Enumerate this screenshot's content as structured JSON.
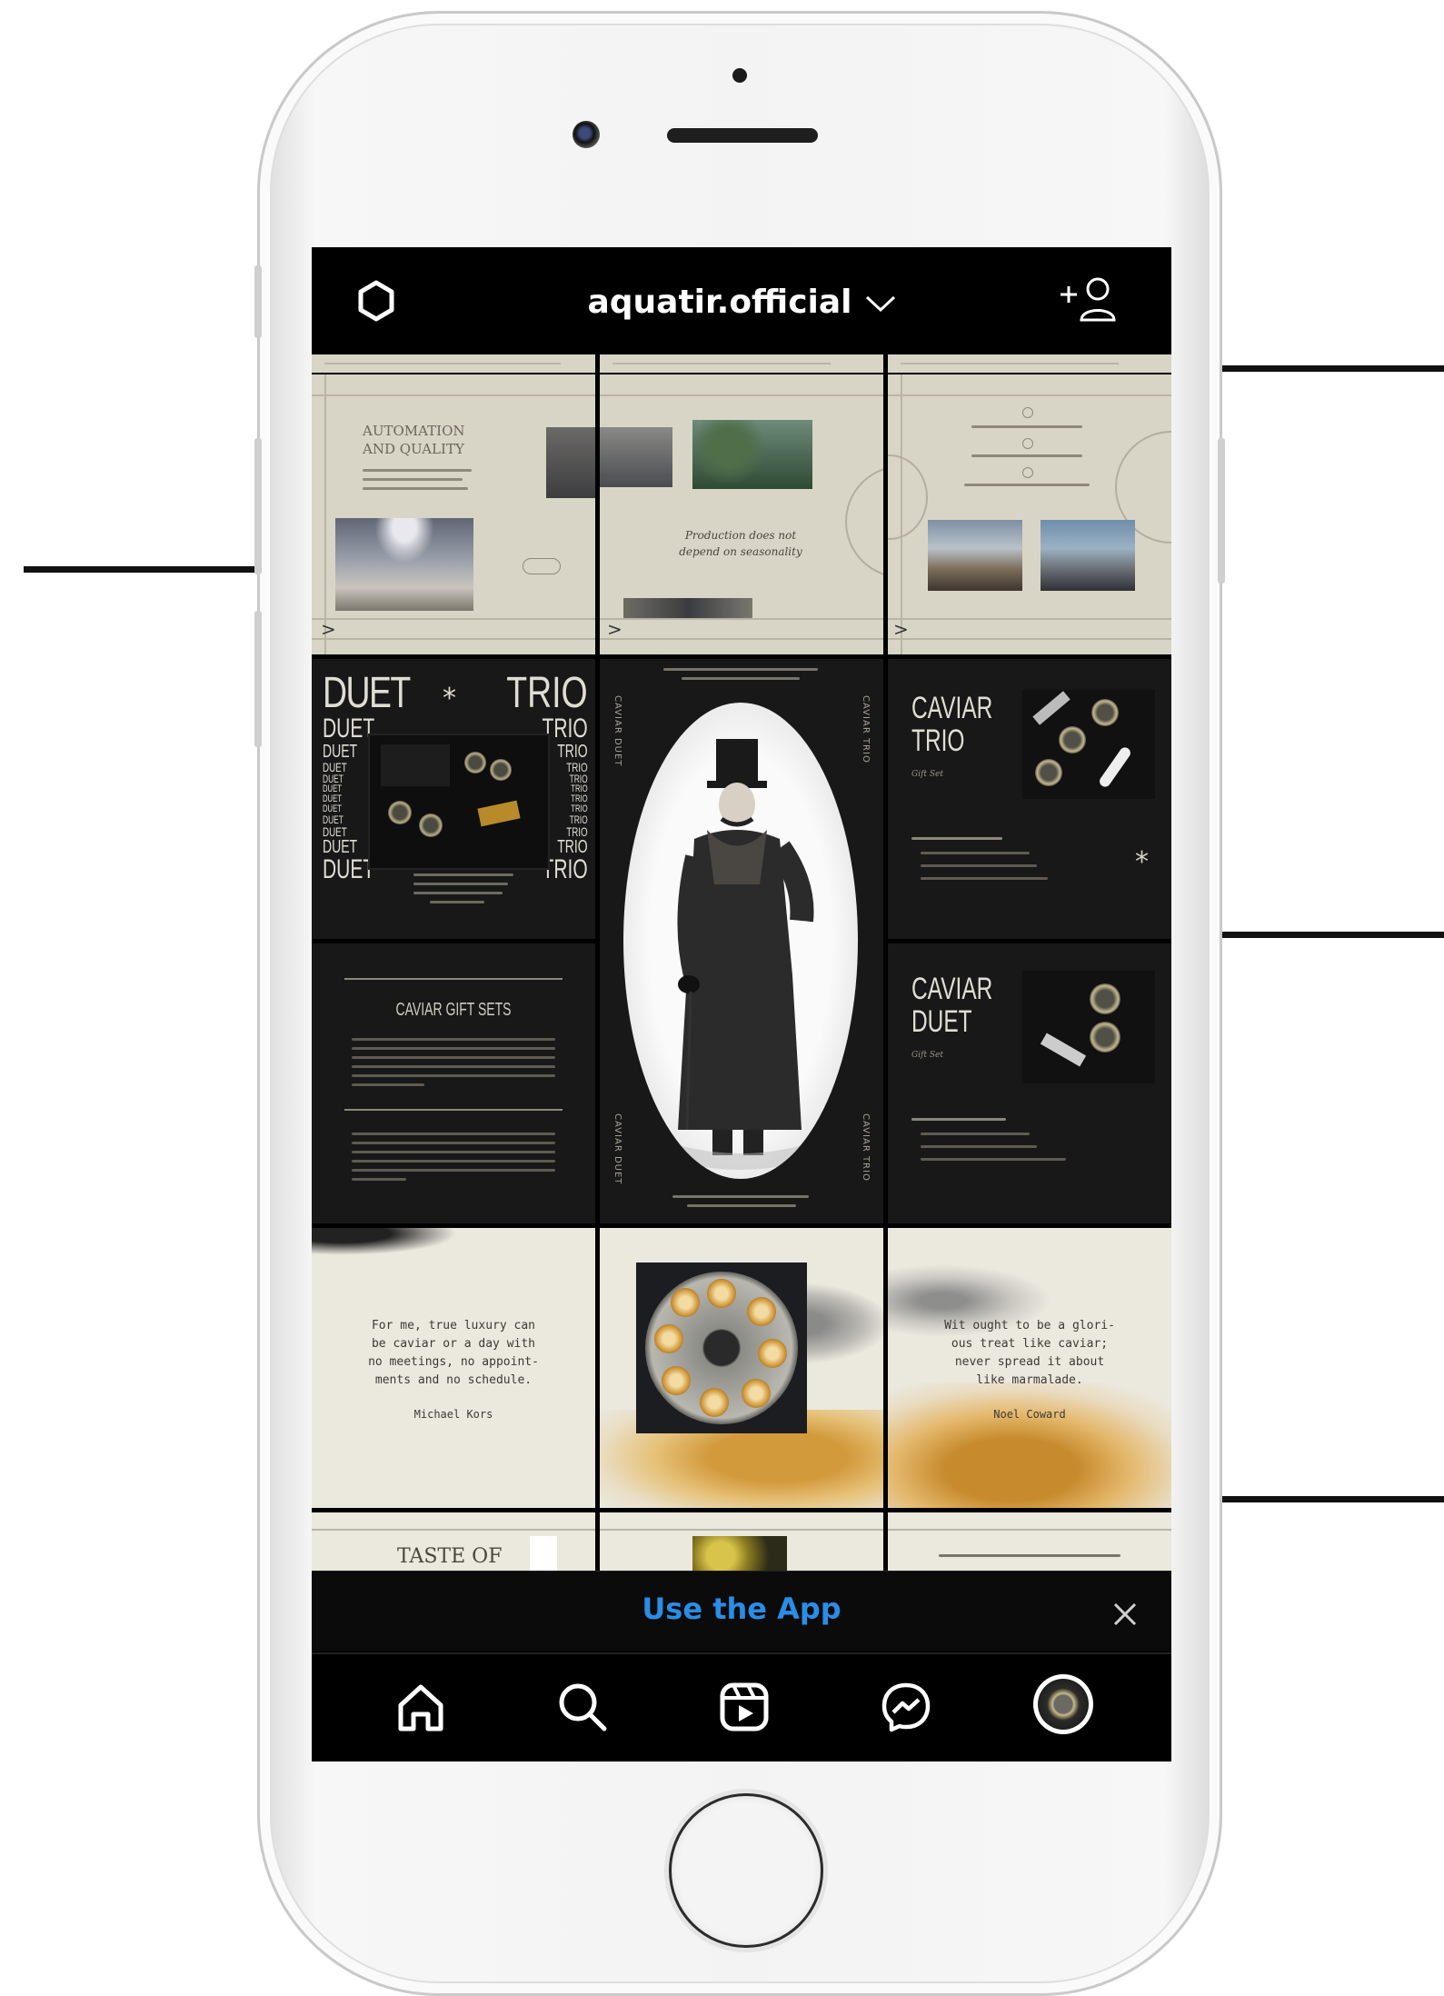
{
  "header": {
    "username": "aquatir.official",
    "left_icon": "settings-icon",
    "right_icon": "add-person-icon",
    "dropdown_icon": "chevron-down-icon"
  },
  "posts": {
    "automation_title_1": "AUTOMATION",
    "automation_title_2": "AND QUALITY",
    "production_quote_1": "Production does not",
    "production_quote_2": "depend on seasonality",
    "duet_word": "DUET",
    "trio_word": "TRIO",
    "star": "*",
    "caviar_trio_1": "CAVIAR",
    "caviar_trio_2": "TRIO",
    "caviar_duet_1": "CAVIAR",
    "caviar_duet_2": "DUET",
    "gift_set": "Gift Set",
    "gift_sets_heading": "CAVIAR GIFT SETS",
    "side_caviar_duet": "CAVIAR DUET",
    "side_caviar_trio": "CAVIAR TRIO",
    "quote_kors_lines": [
      "For me, true luxury can",
      "be caviar or a day with",
      "no meetings, no appoint-",
      "ments and no schedule."
    ],
    "quote_kors_author": "Michael Kors",
    "quote_coward_lines": [
      "Wit ought to be a glori-",
      "ous treat like caviar;",
      "never spread it about",
      "like marmalade."
    ],
    "quote_coward_author": "Noel Coward",
    "taste_of": "TASTE OF"
  },
  "app_banner": {
    "label": "Use the App",
    "close_icon": "close-icon"
  },
  "bottom_nav": {
    "icons": [
      "home-icon",
      "search-icon",
      "reels-icon",
      "messenger-icon",
      "profile-avatar"
    ]
  },
  "colors": {
    "banner_link": "#2a8de6",
    "cream_tile": "#d9d5c6",
    "dark_tile": "#181818"
  }
}
